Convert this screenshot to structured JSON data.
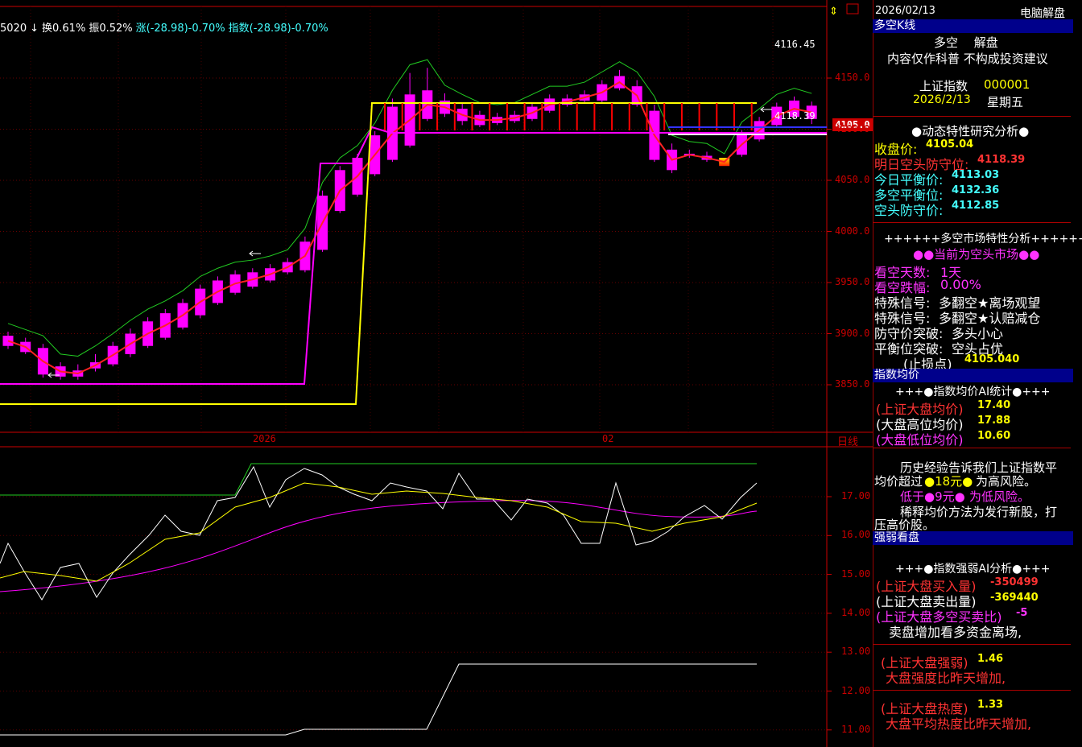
{
  "info_bar": {
    "prefix": "5020",
    "arrow": "↓",
    "turnover": "换0.61%",
    "amplitude": "振0.52%",
    "change": "涨(-28.98)-0.70%",
    "index": "指数(-28.98)-0.70%"
  },
  "header_top": {
    "date": "2026/02/13",
    "title": "电脑解盘"
  },
  "price_axis": [
    "4150.0",
    "4100.0",
    "4050.0",
    "4000.0",
    "3950.0",
    "3900.0",
    "3850.0"
  ],
  "price_tag": "4105.0",
  "annotations": {
    "high": "4116.45",
    "defense": "4118.39"
  },
  "x_axis": {
    "year_label": "2026",
    "month_label": "02",
    "period": "日线"
  },
  "sub_axis": [
    "17.00",
    "16.00",
    "15.00",
    "14.00",
    "13.00",
    "12.00",
    "11.00"
  ],
  "chart_data": {
    "type": "candlestick",
    "candles": [
      [
        3898,
        3902,
        3888,
        3885
      ],
      [
        3892,
        3896,
        3882,
        3880
      ],
      [
        3886,
        3890,
        3860,
        3857
      ],
      [
        3868,
        3872,
        3858,
        3855
      ],
      [
        3864,
        3870,
        3858,
        3855
      ],
      [
        3872,
        3880,
        3866,
        3863
      ],
      [
        3888,
        3892,
        3870,
        3868
      ],
      [
        3900,
        3905,
        3880,
        3877
      ],
      [
        3912,
        3916,
        3888,
        3886
      ],
      [
        3920,
        3924,
        3896,
        3894
      ],
      [
        3930,
        3934,
        3906,
        3904
      ],
      [
        3944,
        3948,
        3918,
        3915
      ],
      [
        3952,
        3956,
        3930,
        3928
      ],
      [
        3958,
        3962,
        3940,
        3938
      ],
      [
        3960,
        3964,
        3946,
        3944
      ],
      [
        3964,
        3968,
        3952,
        3950
      ],
      [
        3970,
        3974,
        3960,
        3958
      ],
      [
        3990,
        3995,
        3962,
        3960
      ],
      [
        4035,
        4040,
        3982,
        3980
      ],
      [
        4060,
        4064,
        4020,
        4018
      ],
      [
        4072,
        4076,
        4036,
        4034
      ],
      [
        4094,
        4098,
        4056,
        4054
      ],
      [
        4122,
        4130,
        4070,
        4068
      ],
      [
        4134,
        4155,
        4084,
        4082
      ],
      [
        4138,
        4160,
        4110,
        4108
      ],
      [
        4128,
        4135,
        4115,
        4112
      ],
      [
        4120,
        4126,
        4108,
        4104
      ],
      [
        4114,
        4118,
        4104,
        4102
      ],
      [
        4112,
        4116,
        4106,
        4104
      ],
      [
        4114,
        4118,
        4108,
        4106
      ],
      [
        4122,
        4126,
        4110,
        4108
      ],
      [
        4130,
        4134,
        4118,
        4116
      ],
      [
        4130,
        4134,
        4124,
        4122
      ],
      [
        4134,
        4138,
        4128,
        4126
      ],
      [
        4144,
        4148,
        4128,
        4126
      ],
      [
        4152,
        4158,
        4140,
        4138
      ],
      [
        4142,
        4148,
        4124,
        4122
      ],
      [
        4118,
        4124,
        4070,
        4068
      ],
      [
        4080,
        4086,
        4060,
        4057
      ],
      [
        4076,
        4080,
        4074,
        4072
      ],
      [
        4074,
        4078,
        4070,
        4068
      ],
      [
        4064,
        4068,
        4072,
        4070
      ],
      [
        4095,
        4099,
        4075,
        4073
      ],
      [
        4108,
        4112,
        4090,
        4088
      ],
      [
        4122,
        4126,
        4104,
        4102
      ],
      [
        4128,
        4132,
        4112,
        4110
      ],
      [
        4123,
        4127,
        4110,
        4105
      ]
    ]
  },
  "panel": {
    "title": "多空K线",
    "line1": "多空　 解盘",
    "line2": "内容仅作科普 不构成投资建议",
    "index_name": "上证指数",
    "index_code": "000001",
    "date": "2026/2/13",
    "weekday": "星期五",
    "dyn_title": "●动态特性研究分析●",
    "close_label": "收盘价:",
    "close_value": "4105.04",
    "defense_label": "明日空头防守位:",
    "defense_value": "4118.39",
    "today_bal_label": "今日平衡价:",
    "today_bal_value": "4113.03",
    "ls_bal_label": "多空平衡位:",
    "ls_bal_value": "4132.36",
    "short_def_label": "空头防守价:",
    "short_def_value": "4112.85",
    "market_title": "++++++多空市场特性分析++++++",
    "market_state": "●●当前为空头市场●●",
    "bear_days_label": "看空天数:",
    "bear_days_value": "1天",
    "bear_drop_label": "看空跌幅:",
    "bear_drop_value": "0.00%",
    "signal1_label": "特殊信号:",
    "signal1_value": "多翻空★离场观望",
    "signal2_label": "特殊信号:",
    "signal2_value": "多翻空★认赔减仓",
    "break1_label": "防守价突破:",
    "break1_value": "多头小心",
    "break2_label": "平衡位突破:",
    "break2_value": "空头占优",
    "stop_label": "(止损点)",
    "stop_value": "4105.040",
    "avg_header": "指数均价",
    "avg_title": "+++●指数均价AI统计●+++",
    "avg1_label": "(上证大盘均价)",
    "avg1_value": "17.40",
    "avg2_label": "(大盘高位均价)",
    "avg2_value": "17.88",
    "avg3_label": "(大盘低位均价)",
    "avg3_value": "10.60",
    "hist1": "历史经验告诉我们上证指数平",
    "hist2a": "均价超过",
    "hist2b": "●18元●",
    "hist2c": "为高风险。",
    "hist3a": "低于",
    "hist3b": "●9元●",
    "hist3c": "为低风险。",
    "hist4": "稀释均价方法为发行新股，打",
    "hist5": "压高价股。",
    "strength_header": "强弱看盘",
    "strength_title": "+++●指数强弱AI分析●+++",
    "buy_label": "(上证大盘买入量)",
    "buy_value": "-350499",
    "sell_label": "(上证大盘卖出量)",
    "sell_value": "-369440",
    "ratio_label": "(上证大盘多空买卖比)",
    "ratio_value": "-5",
    "ratio_note": "卖盘增加看多资金离场,",
    "str_label": "(上证大盘强弱)",
    "str_value": "1.46",
    "str_note": "大盘强度比昨天增加,",
    "heat_label": "(上证大盘热度)",
    "heat_value": "1.33",
    "heat_note": "大盘平均热度比昨天增加,"
  },
  "colors": {
    "bull_top": "#ffe000",
    "bull_bottom": "#ff2000",
    "bear": "#ff00ff",
    "axis": "#c00000",
    "panel_header_bg": "#00008b"
  }
}
